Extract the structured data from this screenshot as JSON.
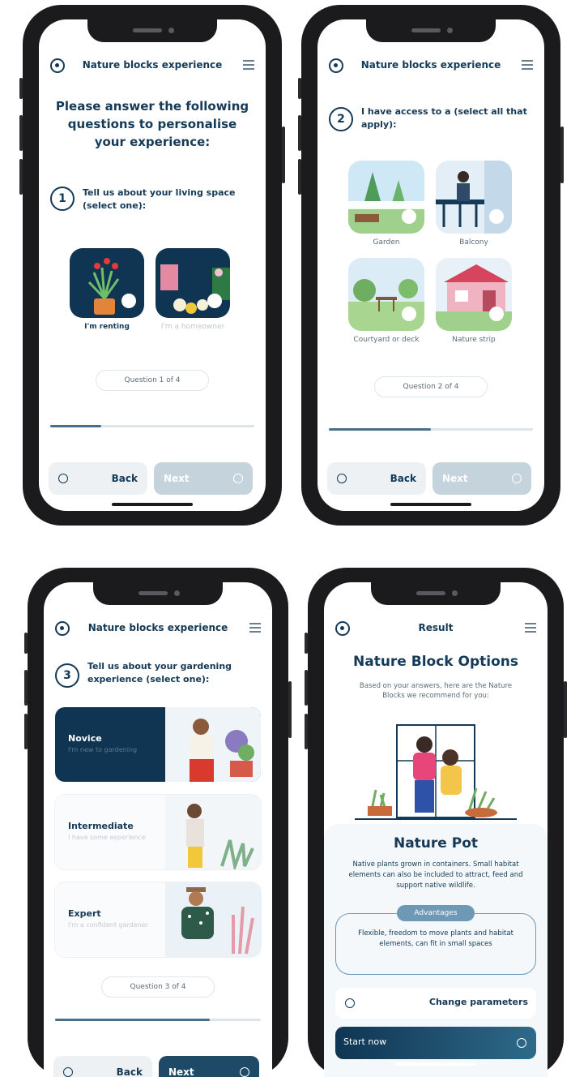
{
  "screens": [
    {
      "header": {
        "title": "Nature blocks experience"
      },
      "heading": "Please answer the following questions to personalise your experience:",
      "question": {
        "number": "1",
        "text": "Tell us about your living space (select one):"
      },
      "options": [
        {
          "label": "I'm renting"
        },
        {
          "label": "I'm a homeowner"
        }
      ],
      "counter": "Question 1 of 4",
      "progress": 0.25,
      "back_label": "Back",
      "next_label": "Next"
    },
    {
      "header": {
        "title": "Nature blocks experience"
      },
      "question": {
        "number": "2",
        "text": "I have access to a (select all that apply):"
      },
      "options": [
        {
          "label": "Garden"
        },
        {
          "label": "Balcony"
        },
        {
          "label": "Courtyard or deck"
        },
        {
          "label": "Nature strip"
        }
      ],
      "counter": "Question 2 of 4",
      "progress": 0.5,
      "back_label": "Back",
      "next_label": "Next"
    },
    {
      "header": {
        "title": "Nature blocks experience"
      },
      "question": {
        "number": "3",
        "text": "Tell us about your gardening experience (select one):"
      },
      "options": [
        {
          "title": "Novice",
          "subtitle": "I'm new to gardening"
        },
        {
          "title": "Intermediate",
          "subtitle": "I have some experience"
        },
        {
          "title": "Expert",
          "subtitle": "I'm a confident gardener"
        }
      ],
      "counter": "Question 3 of 4",
      "progress": 0.75,
      "back_label": "Back",
      "next_label": "Next"
    },
    {
      "header": {
        "title": "Result"
      },
      "heading": "Nature Block Options",
      "intro": "Based on your answers, here are the Nature Blocks we recommend for you:",
      "result": {
        "title": "Nature Pot",
        "description": "Native plants grown in containers. Small habitat elements can also be included to attract, feed and support native wildlife.",
        "advantages_label": "Advantages",
        "advantages_text": "Flexible, freedom to move plants and habitat elements, can fit in small spaces"
      },
      "change_label": "Change parameters",
      "start_label": "Start now"
    }
  ],
  "colors": {
    "primary": "#143a57",
    "dark_card": "#0f3552",
    "next_disabled": "#c5d3dd"
  },
  "icons": [
    "back-circle-icon",
    "menu-icon",
    "radio-dot-icon"
  ]
}
